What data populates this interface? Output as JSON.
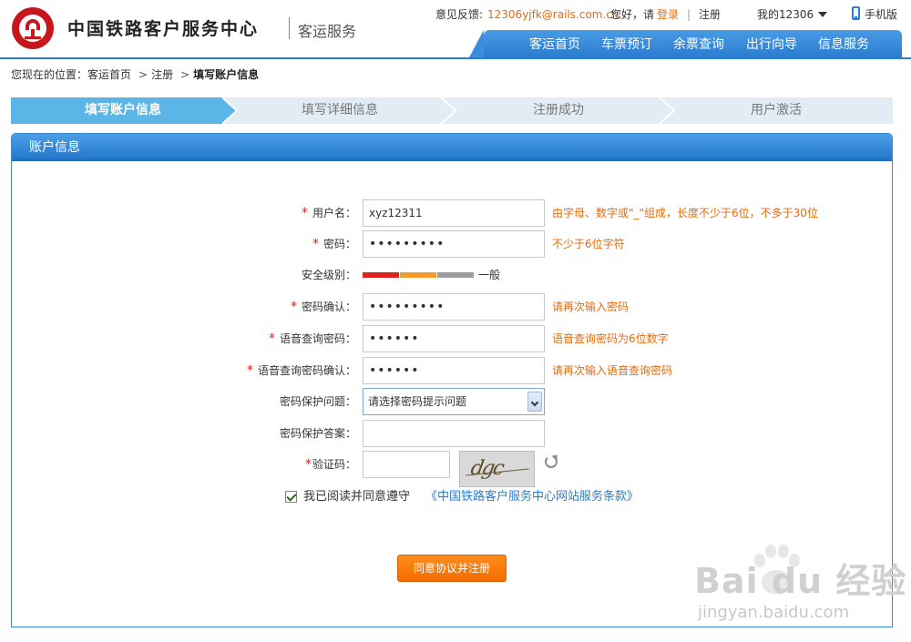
{
  "header": {
    "brand_name": "中国铁路客户服务中心",
    "brand_sub": "客运服务",
    "feedback_label": "意见反馈:",
    "feedback_email": "12306yjfk@rails.com.cn",
    "greeting": "您好，请",
    "login": "登录",
    "separator": "|",
    "register": "注册",
    "my12306": "我的12306",
    "mobile": "手机版",
    "nav": [
      "客运首页",
      "车票预订",
      "余票查询",
      "出行向导",
      "信息服务"
    ]
  },
  "breadcrumb": {
    "prefix": "您现在的位置：",
    "home": "客运首页",
    "gt1": ">",
    "register": "注册",
    "gt2": ">",
    "current": "填写账户信息"
  },
  "steps": [
    "填写账户信息",
    "填写详细信息",
    "注册成功",
    "用户激活"
  ],
  "active_step": 0,
  "colors": {
    "accent_blue": "#2b7dd0",
    "hint_orange": "#e86a0c",
    "step_active": "#5bb5e6",
    "step_inactive": "#e2ecf4",
    "sec_red": "#e0221b",
    "sec_orange": "#f39a2b",
    "sec_gray": "#9d9d9d"
  },
  "panel": {
    "title": "账户信息"
  },
  "form": {
    "required_mark": "*",
    "username": {
      "label": "用户名：",
      "value": "xyz12311",
      "hint": "由字母、数字或\"_\"组成，长度不少于6位，不多于30位"
    },
    "password": {
      "label": "密码：",
      "value": "•••••••••",
      "hint": "不少于6位字符"
    },
    "security": {
      "label": "安全级别：",
      "level": "一般",
      "level_fraction": 0.67
    },
    "password_confirm": {
      "label": "密码确认：",
      "value": "•••••••••",
      "hint": "请再次输入密码"
    },
    "voice_pw": {
      "label": "语音查询密码：",
      "value": "••••••",
      "hint": "语音查询密码为6位数字"
    },
    "voice_pw_confirm": {
      "label": "语音查询密码确认：",
      "value": "••••••",
      "hint": "请再次输入语音查询密码"
    },
    "question": {
      "label": "密码保护问题：",
      "selected": "请选择密码提示问题"
    },
    "answer": {
      "label": "密码保护答案：",
      "value": ""
    },
    "captcha": {
      "label": "验证码：",
      "value": "",
      "image_text": "dgc"
    },
    "agree": {
      "checked": true,
      "text": "我已阅读并同意遵守",
      "link": "《中国铁路客户服务中心网站服务条款》"
    },
    "submit": "同意协议并注册"
  },
  "watermark": {
    "brand": "Bai du 经验",
    "url": "jingyan.baidu.com"
  },
  "icons": [
    "railway-logo-icon",
    "caret-down-icon",
    "phone-icon",
    "select-arrow-icon",
    "refresh-icon",
    "checkbox-check-icon",
    "baidu-paw-icon"
  ]
}
